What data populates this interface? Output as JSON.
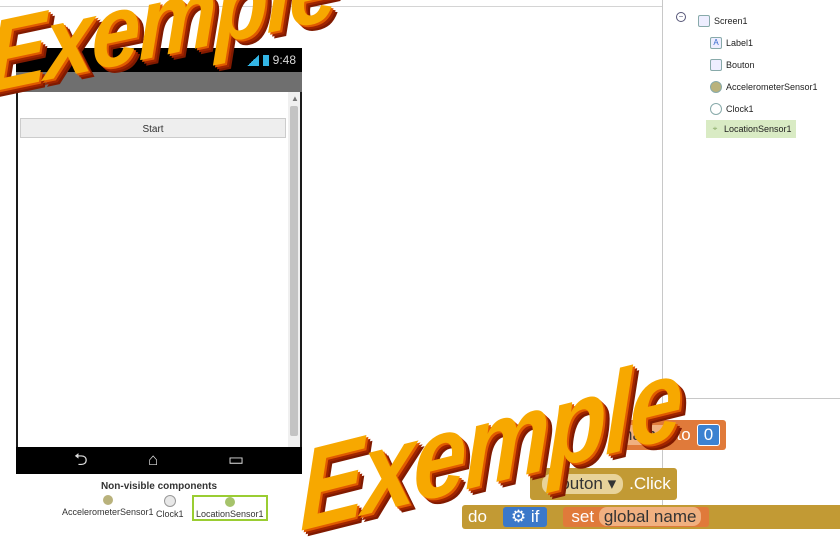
{
  "phone": {
    "status_time": "9:48",
    "start_button": "Start",
    "nav_back_glyph": "⮌",
    "nav_home_glyph": "⌂",
    "nav_recent_glyph": "▭"
  },
  "nonvisible": {
    "title": "Non-visible components",
    "items": [
      "AccelerometerSensor1",
      "Clock1",
      "LocationSensor1"
    ]
  },
  "tree": {
    "root": "Screen1",
    "items": [
      "Label1",
      "Bouton",
      "AccelerometerSensor1",
      "Clock1",
      "LocationSensor1"
    ]
  },
  "watermark": {
    "top": "Exemple",
    "bottom": "Exemple"
  },
  "blocks": {
    "set_name": "name",
    "set_to": "to",
    "set_value": "0",
    "when_component": "Bouton",
    "when_event": ".Click",
    "do_label": "do",
    "if_label": "if",
    "set_label": "set",
    "global_name": "global name"
  },
  "colors": {
    "accent": "#9acd32",
    "watermark_fill": "#f7a800",
    "block_event": "#c29a34",
    "block_var": "#e07a3a",
    "block_control": "#3b78c9"
  }
}
